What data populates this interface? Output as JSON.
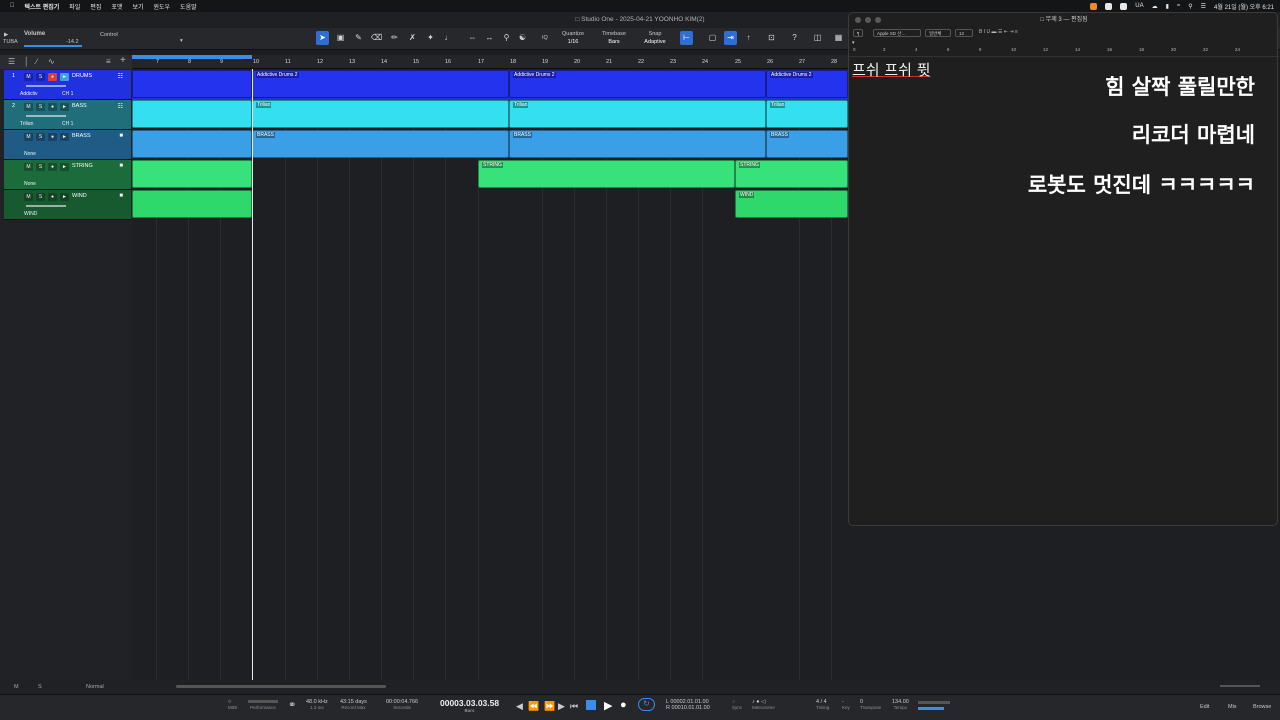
{
  "menubar": {
    "apple": "",
    "app": "텍스트 편집기",
    "items": [
      "파일",
      "편집",
      "포맷",
      "보기",
      "윈도우",
      "도움말"
    ],
    "status_ua": "UA",
    "datetime": "4월 21일 (월) 오후 6:21"
  },
  "window": {
    "title": "Studio One - 2025-04-21 YOONHO KIM(2)"
  },
  "toolbar": {
    "volume_label": "Volume",
    "volume_value": "-14.2",
    "track_label": "TUBA",
    "control_label": "Control",
    "quantize": {
      "label": "Quantize",
      "value": "1/16"
    },
    "timebase": {
      "label": "Timebase",
      "value": "Bars"
    },
    "snap": {
      "label": "Snap",
      "value": "Adaptive"
    },
    "iq_label": "IQ"
  },
  "tracks": [
    {
      "num": "1",
      "name": "DRUMS",
      "sub1": "Addictiv",
      "sub2": "CH 1",
      "color": "#1f2fe6",
      "clip_color": "#2433ee"
    },
    {
      "num": "2",
      "name": "BASS",
      "sub1": "Trilian",
      "sub2": "CH 1",
      "color": "#2bcfe0",
      "clip_color": "#34e0ef"
    },
    {
      "num": "",
      "name": "BRASS",
      "sub1": "None",
      "sub2": "",
      "color": "#2f8fd8",
      "clip_color": "#3a9fe6"
    },
    {
      "num": "",
      "name": "STRING",
      "sub1": "None",
      "sub2": "",
      "color": "#25c25f",
      "clip_color": "#38e27a"
    },
    {
      "num": "",
      "name": "WIND",
      "sub1": "WIND",
      "sub2": "",
      "color": "#1e9a48",
      "clip_color": "#2fd86b"
    }
  ],
  "ruler_ticks": [
    "7",
    "8",
    "9",
    "10",
    "11",
    "12",
    "13",
    "14",
    "15",
    "16",
    "17",
    "18",
    "19",
    "20",
    "21",
    "22",
    "23",
    "24",
    "25",
    "26",
    "27",
    "28"
  ],
  "clip_labels": {
    "drums": "Addictive Drums 2",
    "bass": "Trilian",
    "brass": "BRASS",
    "string": "STRING",
    "wind": "WIND"
  },
  "bottombar": {
    "m": "M",
    "s": "S",
    "mode": "Normal"
  },
  "transport": {
    "midi": "MIDI",
    "performance": "Performance",
    "sample_rate": "48.0 kHz",
    "latency": "1.3 ms",
    "record_max_value": "43:15 days",
    "record_max": "Record Max",
    "seconds_value": "00:00:04.766",
    "seconds": "Seconds",
    "position": "00003.03.03.58",
    "bars": "Bars",
    "loop_start": "00002.01.01.00",
    "loop_end": "00010.01.01.00",
    "l": "L",
    "r": "R",
    "sync": "Sync",
    "metronome": "Metronome",
    "timesig": "4 / 4",
    "timing": "Timing",
    "key": "Key",
    "key_value": "-",
    "transpose_value": "0",
    "transpose": "Transpose",
    "tempo_value": "134.00",
    "tempo": "Tempo",
    "edit": "Edit",
    "mix": "Mix",
    "browse": "Browse"
  },
  "editor": {
    "title": "무제 3 — 편집됨",
    "font_select": "Apple SD 산…",
    "style_select": "일반체",
    "size_select": "12",
    "lines": [
      "프쉬 프쉬 퓟",
      "힘 살짝 풀릴만한",
      "리코더 마렵네",
      "로봇도 멋진데 ㅋㅋㅋㅋㅋ"
    ],
    "ruler_ticks": [
      "0",
      "2",
      "4",
      "6",
      "8",
      "10",
      "12",
      "14",
      "16",
      "18",
      "20",
      "22",
      "24"
    ]
  }
}
